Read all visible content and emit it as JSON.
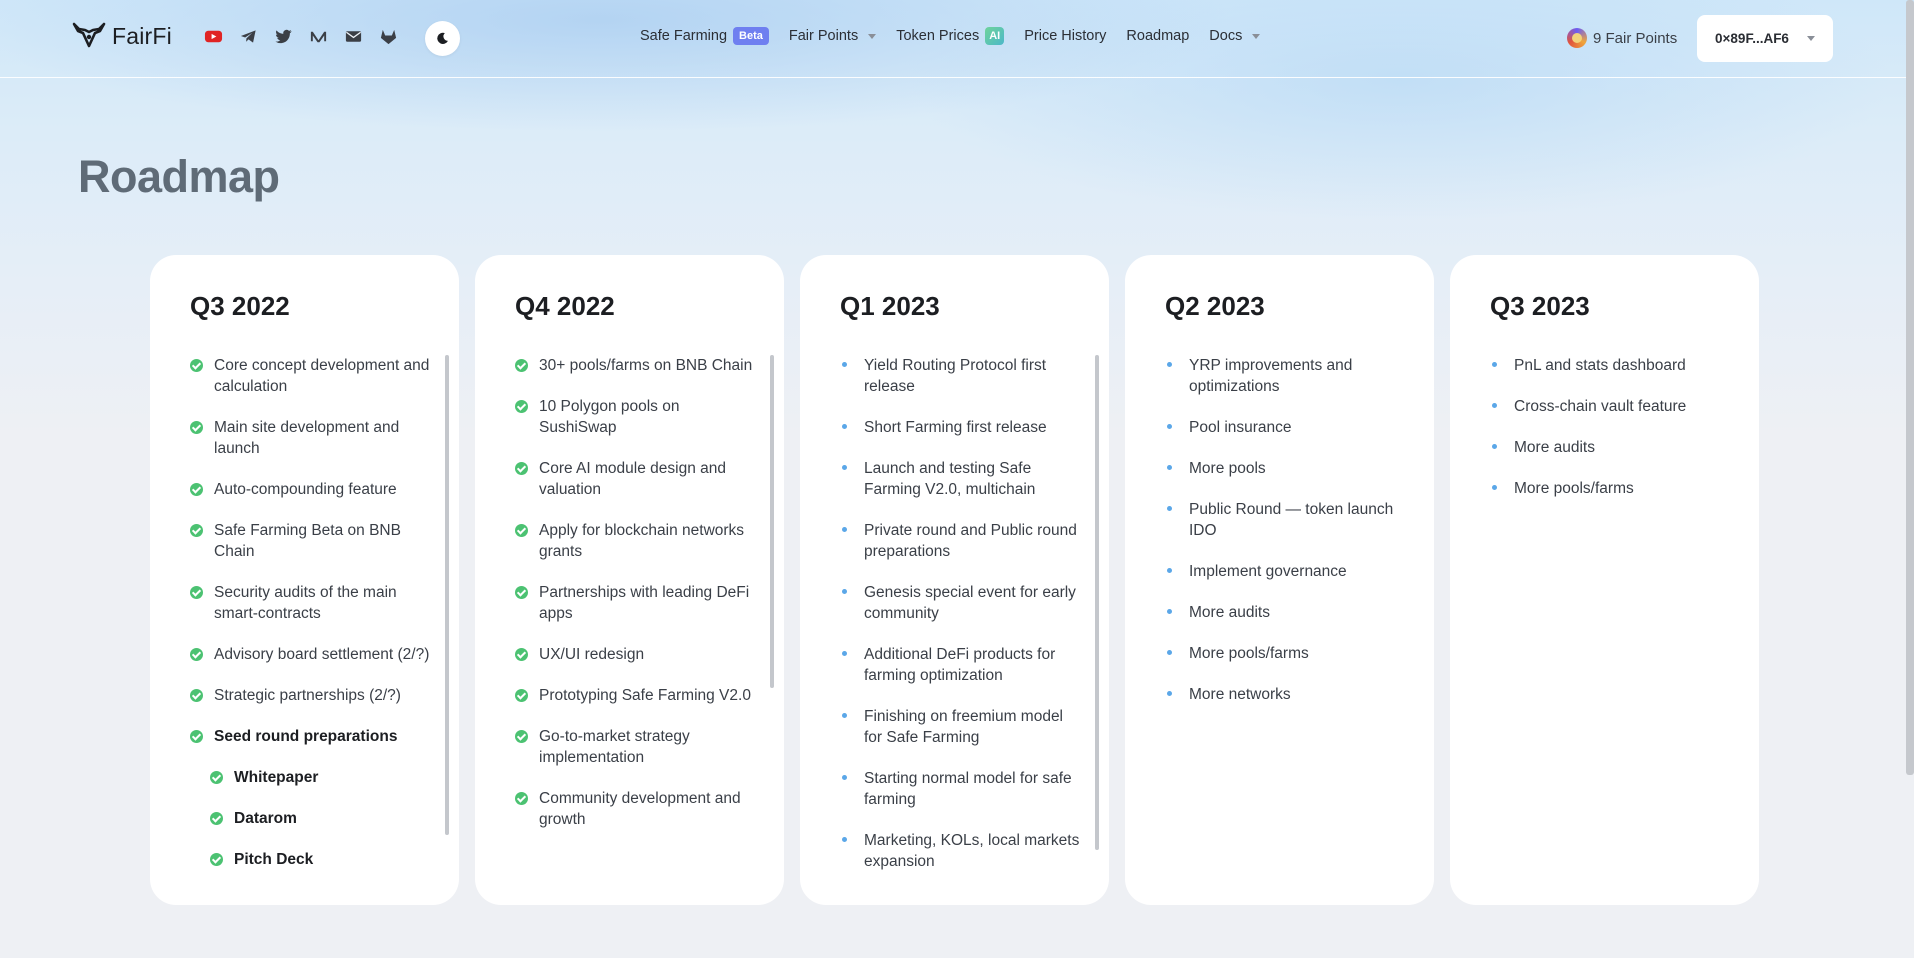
{
  "brand": {
    "name": "FairFi"
  },
  "socials": [
    "youtube-icon",
    "telegram-icon",
    "twitter-icon",
    "medium-icon",
    "mail-icon",
    "gitlab-icon"
  ],
  "nav": {
    "safe_farming": "Safe Farming",
    "beta_badge": "Beta",
    "fair_points": "Fair Points",
    "token_prices": "Token Prices",
    "ai_badge": "AI",
    "price_history": "Price History",
    "roadmap": "Roadmap",
    "docs": "Docs"
  },
  "account": {
    "points": "9 Fair Points",
    "wallet": "0×89F...AF6"
  },
  "page": {
    "title": "Roadmap"
  },
  "colors": {
    "check": "#4cc272",
    "bullet": "#5ba7e8",
    "beta": "#6f7ff0"
  },
  "quarters": [
    {
      "title": "Q3 2022",
      "status": "done",
      "scrollable": true,
      "items": [
        {
          "text": "Core concept development and calculation"
        },
        {
          "text": "Main site development and launch"
        },
        {
          "text": "Auto-compounding feature"
        },
        {
          "text": "Safe Farming Beta on BNB Chain"
        },
        {
          "text": "Security audits of the main smart-contracts"
        },
        {
          "text": "Advisory board settlement (2/?)"
        },
        {
          "text": "Strategic partnerships (2/?)"
        },
        {
          "text": "Seed round preparations",
          "style": "bold"
        },
        {
          "text": "Whitepaper",
          "style": "sub"
        },
        {
          "text": "Datarom",
          "style": "sub"
        },
        {
          "text": "Pitch Deck",
          "style": "sub"
        }
      ]
    },
    {
      "title": "Q4 2022",
      "status": "done",
      "scrollable": true,
      "items": [
        {
          "text": "30+ pools/farms on BNB Chain"
        },
        {
          "text": "10 Polygon pools on SushiSwap"
        },
        {
          "text": "Core AI module design and valuation"
        },
        {
          "text": "Apply for blockchain networks grants"
        },
        {
          "text": "Partnerships with leading DeFi apps"
        },
        {
          "text": "UX/UI redesign"
        },
        {
          "text": "Prototyping Safe Farming V2.0"
        },
        {
          "text": "Go-to-market strategy implementation"
        },
        {
          "text": "Community development and growth"
        }
      ]
    },
    {
      "title": "Q1 2023",
      "status": "planned",
      "scrollable": true,
      "items": [
        {
          "text": "Yield Routing Protocol first release"
        },
        {
          "text": "Short Farming first release"
        },
        {
          "text": "Launch and testing Safe Farming V2.0, multichain"
        },
        {
          "text": "Private round and Public round preparations"
        },
        {
          "text": "Genesis special event for early community"
        },
        {
          "text": "Additional DeFi products for farming optimization"
        },
        {
          "text": "Finishing on freemium model for Safe Farming"
        },
        {
          "text": "Starting normal model for safe farming"
        },
        {
          "text": "Marketing, KOLs, local markets expansion"
        }
      ]
    },
    {
      "title": "Q2 2023",
      "status": "planned",
      "scrollable": false,
      "items": [
        {
          "text": "YRP improvements and optimizations"
        },
        {
          "text": "Pool insurance"
        },
        {
          "text": "More pools"
        },
        {
          "text": "Public Round — token launch IDO"
        },
        {
          "text": "Implement governance"
        },
        {
          "text": "More audits"
        },
        {
          "text": "More pools/farms"
        },
        {
          "text": "More networks"
        }
      ]
    },
    {
      "title": "Q3 2023",
      "status": "planned",
      "scrollable": false,
      "items": [
        {
          "text": "PnL and stats dashboard"
        },
        {
          "text": "Cross-chain vault feature"
        },
        {
          "text": "More audits"
        },
        {
          "text": "More pools/farms"
        }
      ]
    }
  ]
}
